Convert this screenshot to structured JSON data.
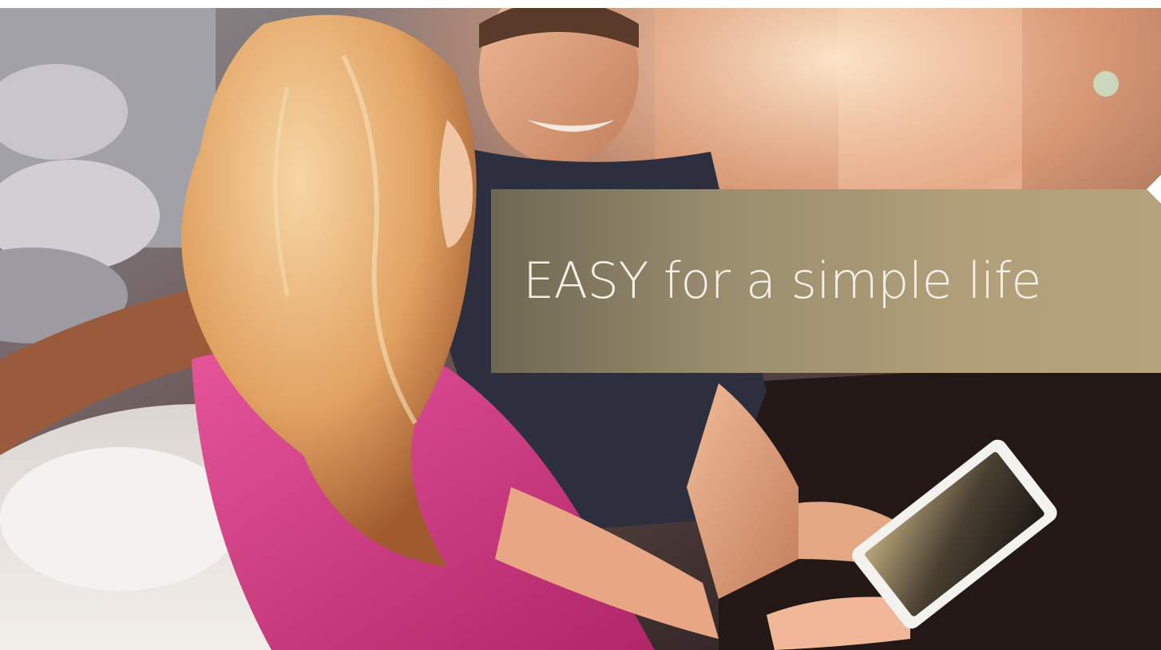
{
  "banner": {
    "headline": "EASY for a simple life",
    "background_color": "#a99a75",
    "text_color": "#f5f1e8"
  },
  "photo": {
    "subjects": [
      "woman-pink-shirt",
      "man-dark-shirt",
      "tablet"
    ],
    "palette": {
      "pink_shirt": "#d03c80",
      "hair": "#e3a766",
      "dark_shirt": "#2d2f3e",
      "sofa": "#e8e3dd",
      "window_light": "#f4c7a0"
    }
  }
}
